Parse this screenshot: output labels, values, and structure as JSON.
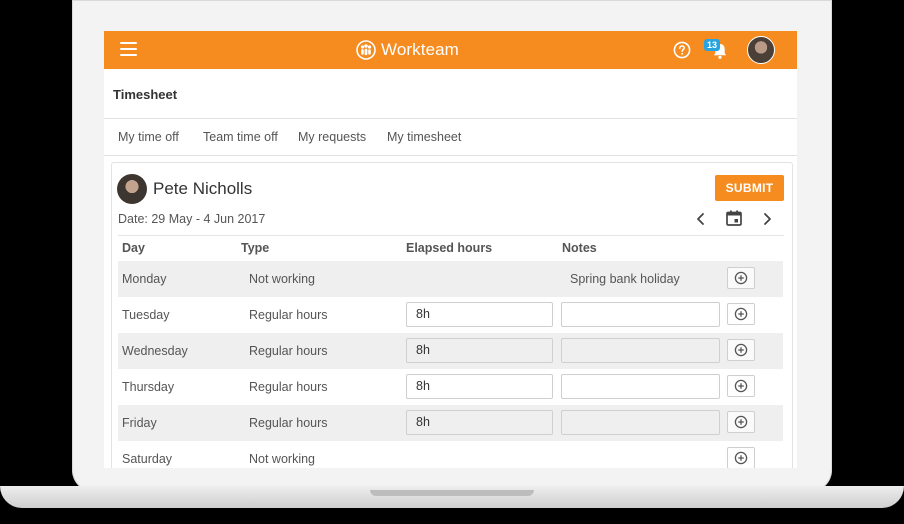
{
  "app": {
    "brand": "Workteam"
  },
  "header": {
    "notification_count": "13"
  },
  "page": {
    "title": "Timesheet"
  },
  "tabs": [
    {
      "label": "My time off"
    },
    {
      "label": "Team time off"
    },
    {
      "label": "My requests"
    },
    {
      "label": "My timesheet"
    }
  ],
  "timesheet": {
    "employee": "Pete Nicholls",
    "submit_label": "SUBMIT",
    "date_range": "Date: 29 May - 4 Jun 2017",
    "columns": {
      "day": "Day",
      "type": "Type",
      "hours": "Elapsed hours",
      "notes": "Notes"
    },
    "rows": [
      {
        "day": "Monday",
        "type": "Not working",
        "hours": "",
        "notes": "Spring bank holiday",
        "editable": false
      },
      {
        "day": "Tuesday",
        "type": "Regular hours",
        "hours": "8h",
        "notes": "",
        "editable": true
      },
      {
        "day": "Wednesday",
        "type": "Regular hours",
        "hours": "8h",
        "notes": "",
        "editable": true
      },
      {
        "day": "Thursday",
        "type": "Regular hours",
        "hours": "8h",
        "notes": "",
        "editable": true
      },
      {
        "day": "Friday",
        "type": "Regular hours",
        "hours": "8h",
        "notes": "",
        "editable": true
      },
      {
        "day": "Saturday",
        "type": "Not working",
        "hours": "",
        "notes": "",
        "editable": false
      }
    ]
  },
  "colors": {
    "accent": "#f68b1f",
    "badge": "#29a3e0",
    "row_shade": "#efefef"
  }
}
